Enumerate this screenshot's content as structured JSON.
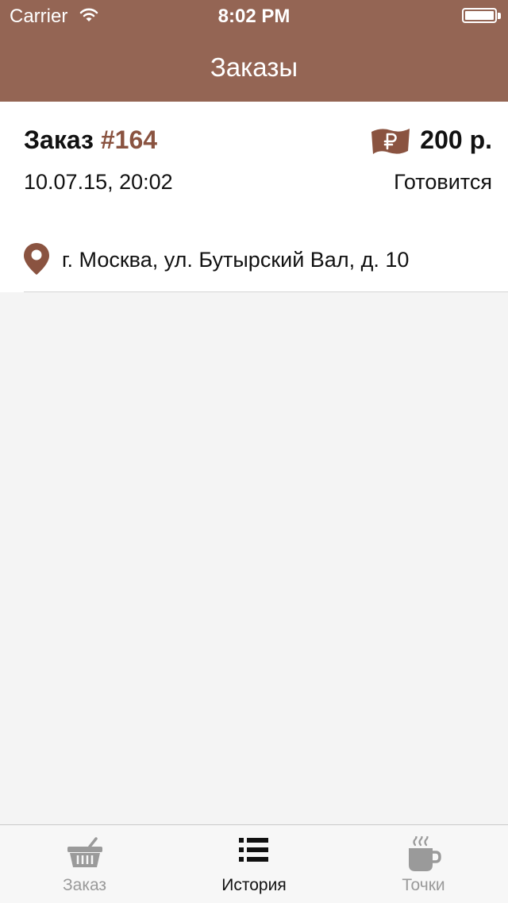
{
  "status_bar": {
    "carrier": "Carrier",
    "time": "8:02 PM"
  },
  "header": {
    "title": "Заказы"
  },
  "order": {
    "title_prefix": "Заказ",
    "number": "#164",
    "price": "200 р.",
    "datetime": "10.07.15, 20:02",
    "status": "Готовится",
    "address": "г. Москва, ул. Бутырский Вал, д. 10"
  },
  "tabs": [
    {
      "label": "Заказ",
      "icon": "basket-icon",
      "selected": false
    },
    {
      "label": "История",
      "icon": "list-icon",
      "selected": true
    },
    {
      "label": "Точки",
      "icon": "coffee-cup-icon",
      "selected": false
    }
  ],
  "colors": {
    "accent": "#946554",
    "order_number": "#8a5340",
    "background": "#f4f4f4",
    "tab_inactive": "#9a9a9a"
  }
}
